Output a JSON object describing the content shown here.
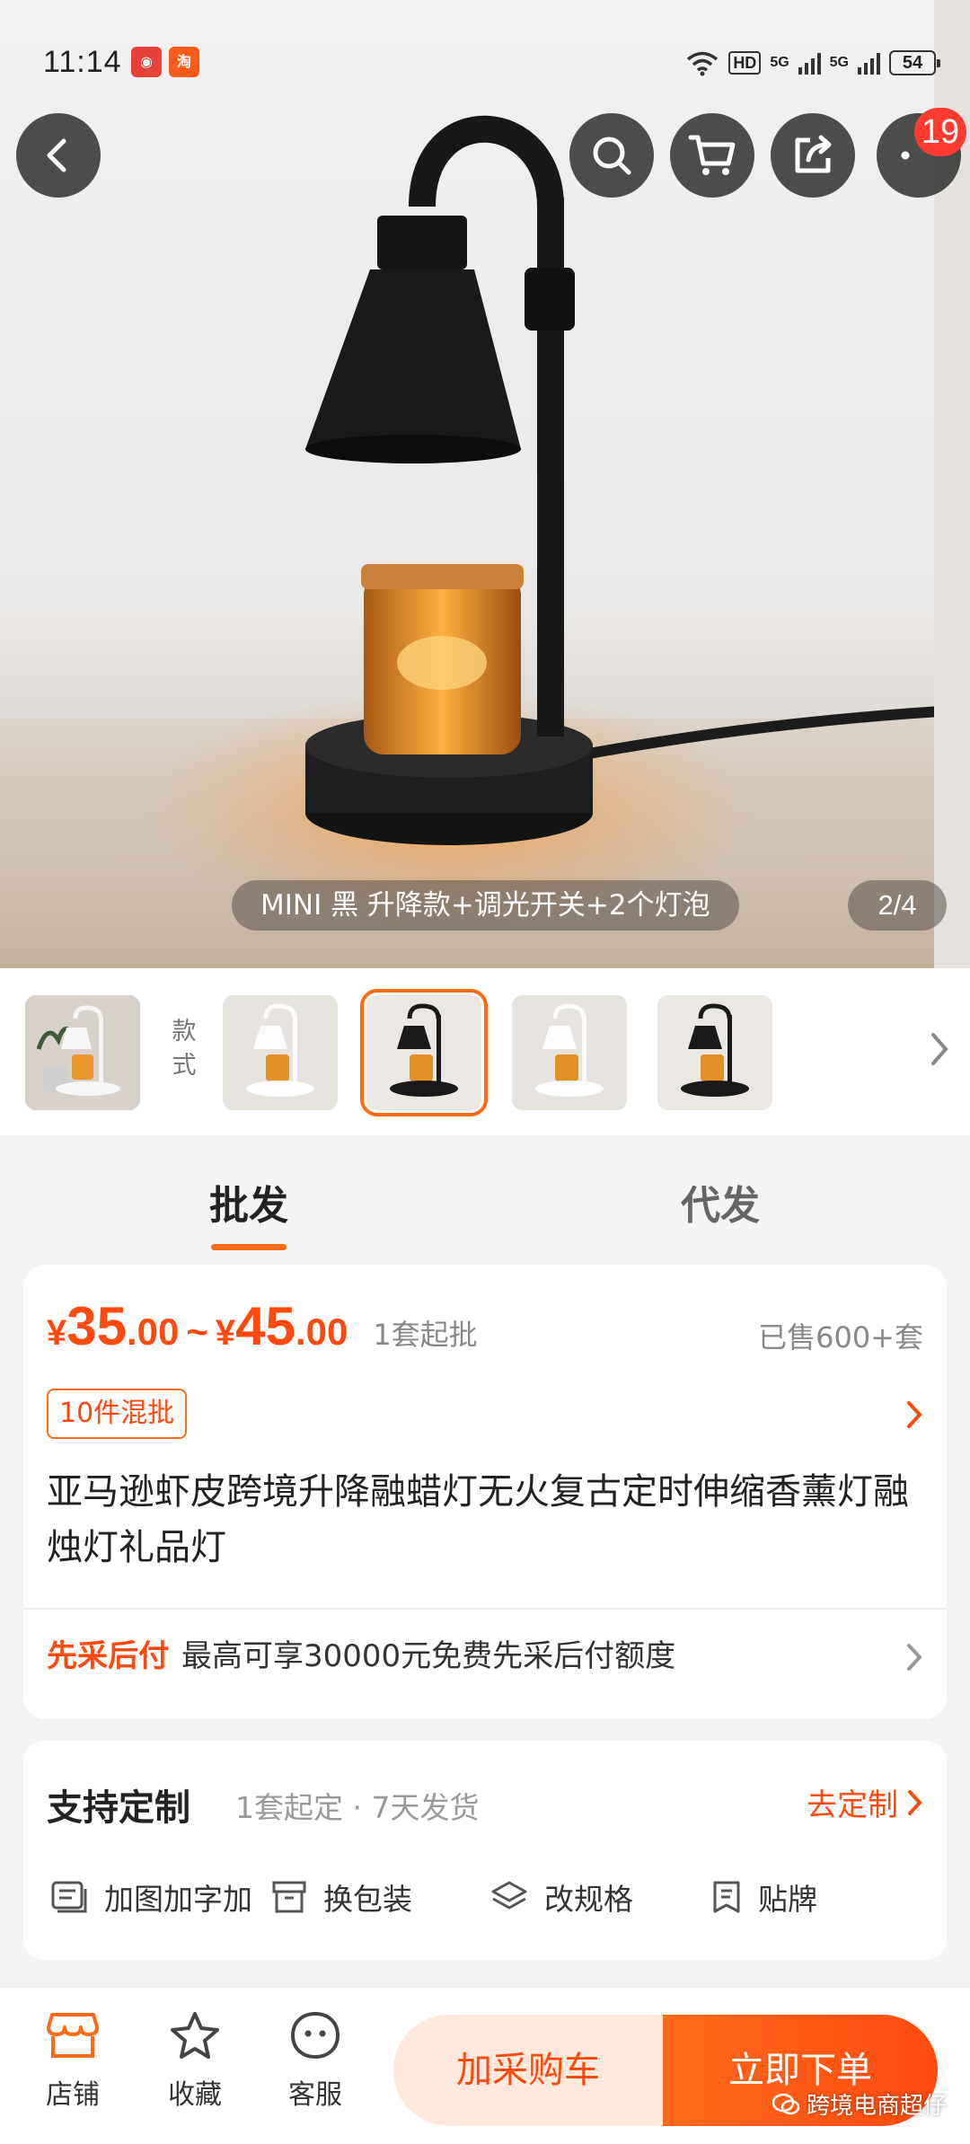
{
  "status_bar": {
    "time": "11:14",
    "hd_label": "HD",
    "net1": "5G",
    "net2": "5G",
    "battery": "54"
  },
  "header": {
    "back_icon": "chevron-left-icon",
    "search_icon": "search-icon",
    "cart_icon": "cart-icon",
    "share_icon": "share-icon",
    "more_icon": "more-icon",
    "more_badge": "19"
  },
  "gallery": {
    "variant_label": "MINI 黑 升降款+调光开关+2个灯泡",
    "page_indicator": "2/4",
    "style_label": "款式"
  },
  "tabs": [
    "批发",
    "代发"
  ],
  "price": {
    "min_int": "35",
    "min_dec": ".00",
    "max_int": "45",
    "max_dec": ".00",
    "currency": "¥",
    "separator": "~",
    "moq": "1套起批",
    "sold": "已售600+套",
    "mix_tag": "10件混批"
  },
  "product": {
    "title": "亚马逊虾皮跨境升降融蜡灯无火复古定时伸缩香薰灯融烛灯礼品灯"
  },
  "payment": {
    "label": "先采后付",
    "text": "最高可享30000元免费先采后付额度"
  },
  "customization": {
    "title": "支持定制",
    "meta": "1套起定 · 7天发货",
    "link": "去定制",
    "options": [
      "加图加字加",
      "换包装",
      "改规格",
      "贴牌"
    ]
  },
  "bottom_nav": {
    "items": [
      "店铺",
      "收藏",
      "客服"
    ],
    "cart_button": "加采购车",
    "buy_button": "立即下单"
  },
  "watermark": "跨境电商超仔",
  "colors": {
    "accent": "#ff6a16",
    "price": "#ff4a0f",
    "cart_bg": "#ffe8dc"
  }
}
